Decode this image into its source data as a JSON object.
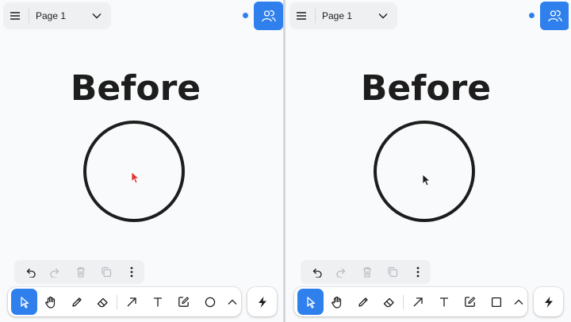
{
  "left": {
    "page_menu": {
      "page_name": "Page 1"
    },
    "canvas": {
      "heading": "Before",
      "cursor_color": "#e03131"
    },
    "toolbar_last_shape": "ellipse"
  },
  "right": {
    "page_menu": {
      "page_name": "Page 1"
    },
    "canvas": {
      "heading": "Before",
      "cursor_color": "#1d1d1d"
    },
    "toolbar_last_shape": "rectangle"
  },
  "icons": {
    "menu": "hamburger-icon",
    "page_dropdown": "chevron-down-icon",
    "share": "people-icon",
    "actions": [
      "undo-icon",
      "redo-icon",
      "trash-icon",
      "duplicate-icon",
      "more-vertical-icon"
    ],
    "tools": [
      "select-icon",
      "hand-icon",
      "draw-icon",
      "eraser-icon",
      "arrow-icon",
      "text-icon",
      "note-icon",
      "shape-icon",
      "chevron-up-icon"
    ],
    "helper": "lightning-icon"
  },
  "colors": {
    "accent": "#2f80ed",
    "stroke": "#1d1d1d",
    "background": "#f9fafb"
  }
}
